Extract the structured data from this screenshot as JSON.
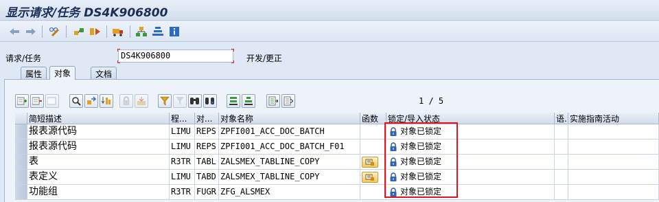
{
  "window": {
    "title": "显示请求/任务 DS4K906800"
  },
  "toolbar": {
    "icons": [
      "back-icon",
      "forward-icon",
      "display-change-icon",
      "where-used-icon",
      "release-icon",
      "transport-truck-icon",
      "hierarchy-icon",
      "sort-icon",
      "info-icon"
    ]
  },
  "header": {
    "request_label": "请求/任务",
    "request_value": "DS4K906800",
    "request_text": "开发/更正"
  },
  "tabs": [
    {
      "label": "属性",
      "active": false
    },
    {
      "label": "对象",
      "active": true
    },
    {
      "label": "文档",
      "active": false
    }
  ],
  "pager": "1 / 5",
  "table": {
    "columns": [
      "简短描述",
      "程...",
      "对...",
      "对象名称",
      "函数",
      "锁定/导入状态",
      "语.",
      "实施指南活动"
    ],
    "rows": [
      {
        "desc": "报表源代码",
        "pgm": "LIMU",
        "obj": "REPS",
        "name": "ZPFI001_ACC_DOC_BATCH",
        "func": false,
        "status": "对象已锁定"
      },
      {
        "desc": "报表源代码",
        "pgm": "LIMU",
        "obj": "REPS",
        "name": "ZPFI001_ACC_DOC_BATCH_F01",
        "func": false,
        "status": "对象已锁定"
      },
      {
        "desc": "表",
        "pgm": "R3TR",
        "obj": "TABL",
        "name": "ZALSMEX_TABLINE_COPY",
        "func": true,
        "status": "对象已锁定"
      },
      {
        "desc": "表定义",
        "pgm": "LIMU",
        "obj": "TABD",
        "name": "ZALSMEX_TABLINE_COPY",
        "func": true,
        "status": "对象已锁定"
      },
      {
        "desc": "功能组",
        "pgm": "R3TR",
        "obj": "FUGR",
        "name": "ZFG_ALSMEX",
        "func": false,
        "status": "对象已锁定"
      }
    ]
  },
  "colors": {
    "highlight_box": "#e0141e",
    "title_text": "#1a2f55"
  }
}
